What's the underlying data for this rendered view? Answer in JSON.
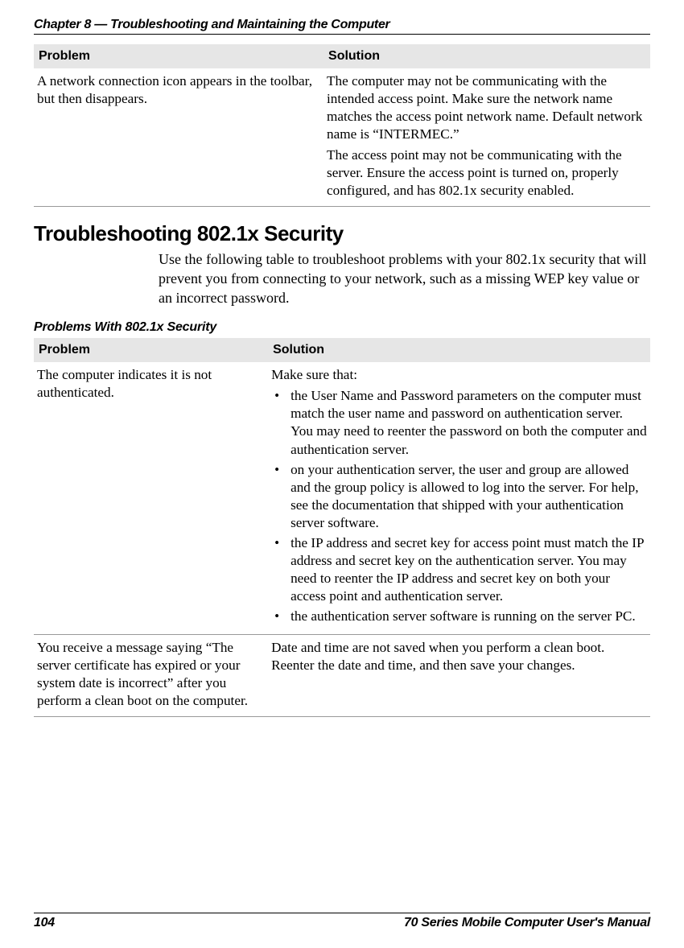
{
  "header": {
    "chapter_line": "Chapter 8 — Troubleshooting and Maintaining the Computer"
  },
  "table1": {
    "headers": {
      "problem": "Problem",
      "solution": "Solution"
    },
    "row": {
      "problem": "A network connection icon appears in the toolbar, but then disappears.",
      "solution_p1": "The computer may not be communicating with the intended access point. Make sure the network name matches the access point network name. Default network name is “INTERMEC.”",
      "solution_p2": "The access point may not be communicating with the server. Ensure the access point is turned on, properly configured, and has 802.1x security enabled."
    }
  },
  "section": {
    "heading": "Troubleshooting 802.1x Security",
    "intro": "Use the following table to troubleshoot problems with your 802.1x security that will prevent you from connecting to your network, such as a missing WEP key value or an incorrect password."
  },
  "table2": {
    "caption": "Problems With 802.1x Security",
    "headers": {
      "problem": "Problem",
      "solution": "Solution"
    },
    "rows": [
      {
        "problem": "The computer indicates it is not authenticated.",
        "solution_lead": "Make sure that:",
        "bullets": [
          "the User Name and Password parameters on the computer must match the user name and password on authentication server. You may need to reenter the password on both the computer and authentication server.",
          "on your authentication server, the user and group are allowed and the group policy is allowed to log into the server. For help, see the documentation that shipped with your authentication server software.",
          "the IP address and secret key for access point must match the IP address and secret key on the authentication server. You may need to reenter the IP address and secret key on both your access point and authentication server.",
          "the authentication server software is running on the server PC."
        ]
      },
      {
        "problem": "You receive a message saying “The server certificate has expired or your system date is incorrect” after you perform a clean boot on the computer.",
        "solution": "Date and time are not saved when you perform a clean boot. Reenter the date and time, and then save your changes."
      }
    ]
  },
  "footer": {
    "page_number": "104",
    "manual_title": "70 Series Mobile Computer User's Manual"
  }
}
